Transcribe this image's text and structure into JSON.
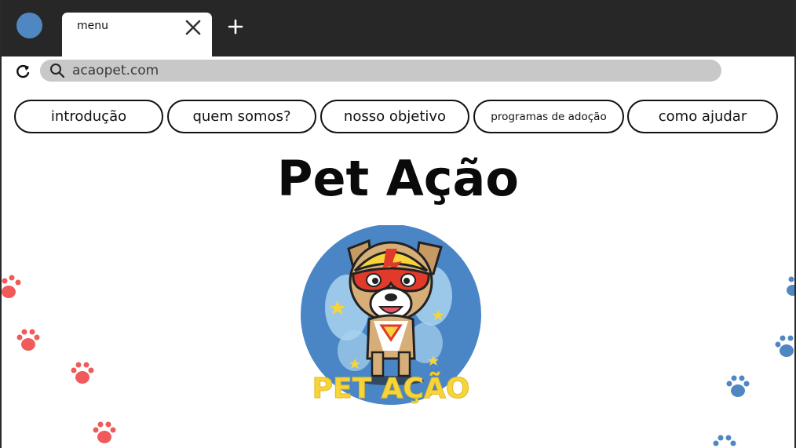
{
  "browser": {
    "tab_title": "menu",
    "address": "acaopet.com",
    "icons": {
      "profile": "profile-avatar-icon",
      "close": "close-icon",
      "new_tab": "plus-icon",
      "reload": "reload-icon",
      "search": "search-icon"
    }
  },
  "nav": {
    "items": [
      {
        "label": "introdução"
      },
      {
        "label": "quem somos?"
      },
      {
        "label": "nosso objetivo"
      },
      {
        "label": "programas de adoção"
      },
      {
        "label": "como ajudar"
      }
    ]
  },
  "page": {
    "title": "Pet Ação",
    "logo_text": "PET AÇÃO",
    "logo_icon": "superhero-dog-logo"
  },
  "colors": {
    "titlebar": "#272727",
    "profile": "#4f87c2",
    "address_bar": "#c8c8c8",
    "paw_red": "#f05a5a",
    "paw_blue": "#4f87c2",
    "logo_yellow": "#f7d53a"
  }
}
